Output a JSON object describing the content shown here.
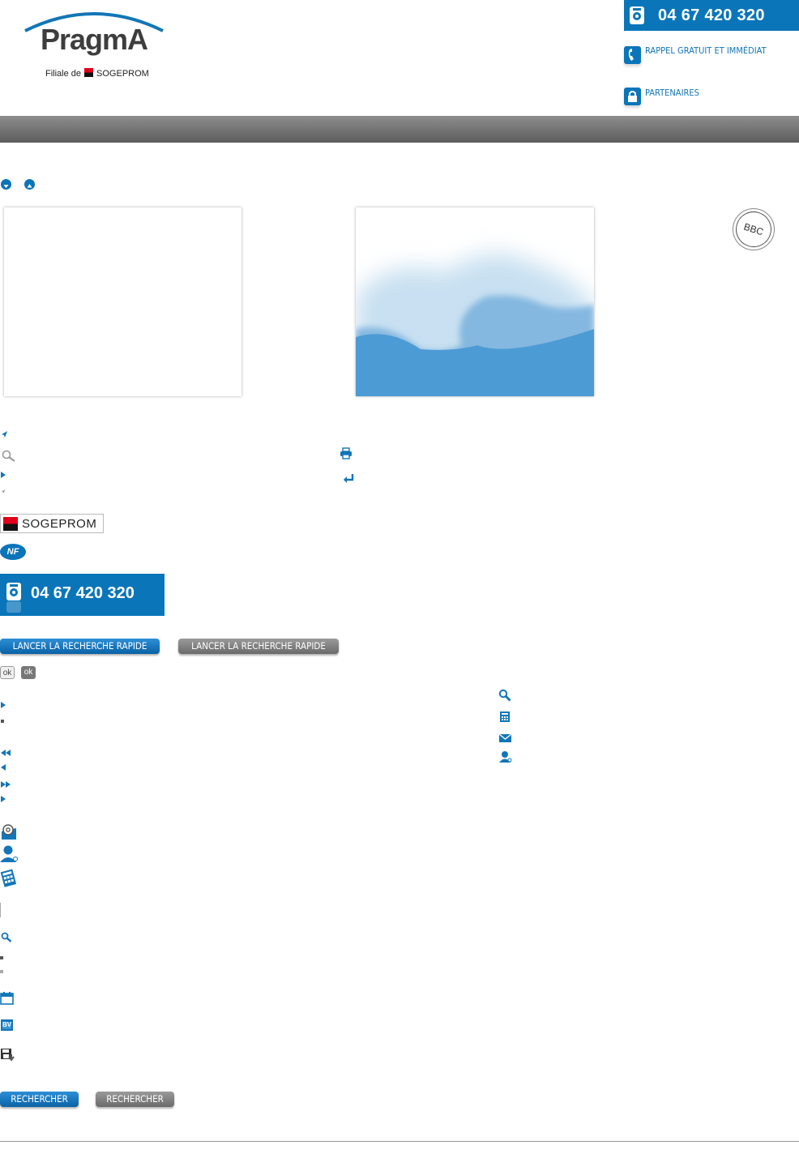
{
  "header": {
    "logo_name": "PragmA",
    "logo_subtitle_prefix": "Filiale de",
    "logo_subtitle_brand": "SOGEPROM",
    "phone_top": "04 67 420 320",
    "callback_link": "RAPPEL GRATUIT ET IMMÉDIAT",
    "partners_link": "PARTENAIRES"
  },
  "bbc_badge": {
    "label": "BBC"
  },
  "sogeprom_logo": "SOGEPROM",
  "nf_badge": "NF",
  "phone_block": "04 67 420 320",
  "quick_search": {
    "button_blue": "LANCER LA RECHERCHE RAPIDE",
    "button_grey": "LANCER LA RECHERCHE RAPIDE"
  },
  "ok_buttons": {
    "light": "ok",
    "dark": "ok"
  },
  "search_buttons": {
    "button_blue": "RECHERCHER",
    "button_grey": "RECHERCHER"
  },
  "icons": {
    "calendar_label": "BV"
  },
  "colors": {
    "accent": "#0a75b9",
    "header_bar": "#6e6e6e",
    "link": "#1276b8"
  }
}
